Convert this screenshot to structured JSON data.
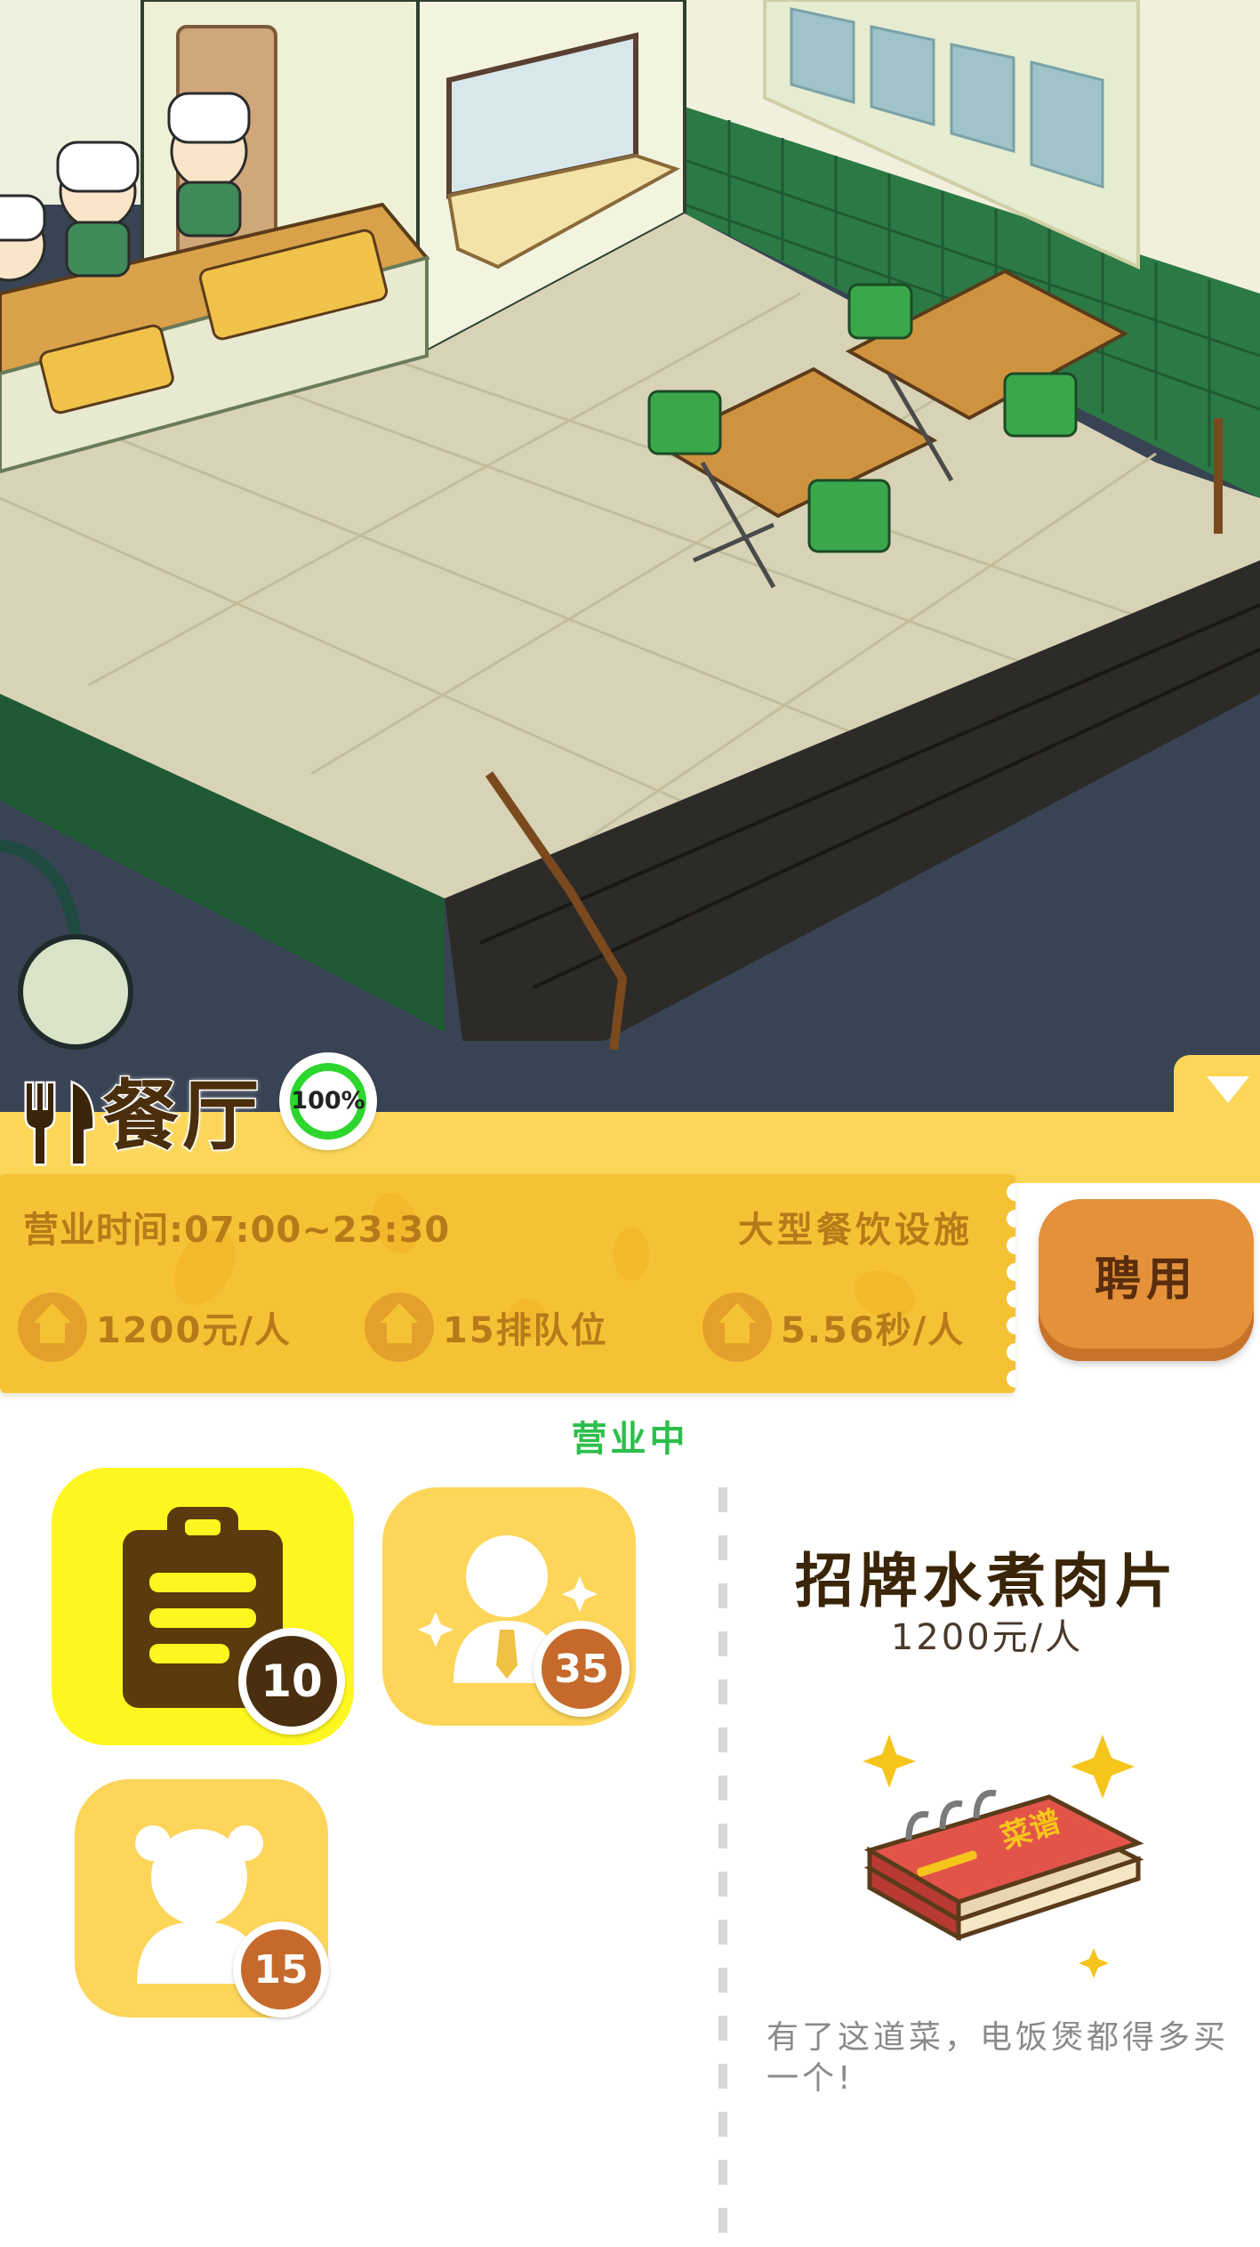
{
  "scene": {
    "description_icons": [
      "chef-icon",
      "counter-icon",
      "table-icon",
      "chair-icon",
      "stairs-icon",
      "lamp-icon",
      "menu-board-icon"
    ]
  },
  "header": {
    "title": "餐厅",
    "completion_label": "100%",
    "completion_value": 100,
    "icon": "fork-knife-icon",
    "collapse_icon": "chevron-down-icon"
  },
  "info": {
    "hours": "营业时间:07:00~23:30",
    "facility": "大型餐饮设施",
    "stats": [
      {
        "icon": "house-icon",
        "value": "1200元/人"
      },
      {
        "icon": "house-icon",
        "value": "15排队位"
      },
      {
        "icon": "house-icon",
        "value": "5.56秒/人"
      }
    ]
  },
  "hire_button": "聘用",
  "status": "营业中",
  "tiles": [
    {
      "icon": "clipboard-icon",
      "badge": "10",
      "selected": true
    },
    {
      "icon": "waiter-icon",
      "badge": "35",
      "selected": false
    },
    {
      "icon": "customer-icon",
      "badge": "15",
      "selected": false
    }
  ],
  "recipe": {
    "name": "招牌水煮肉片",
    "price": "1200元/人",
    "book_label": "菜谱",
    "description": "有了这道菜，电饭煲都得多买一个!"
  },
  "colors": {
    "header_yellow": "#fbd658",
    "card_yellow": "#f6c235",
    "selected_tile": "#fef71f",
    "tile_yellow": "#fcd559",
    "badge_dark": "#4a2e10",
    "badge_orange": "#c56a2c",
    "hire_orange": "#e4913a",
    "status_green": "#2cbf4a"
  }
}
